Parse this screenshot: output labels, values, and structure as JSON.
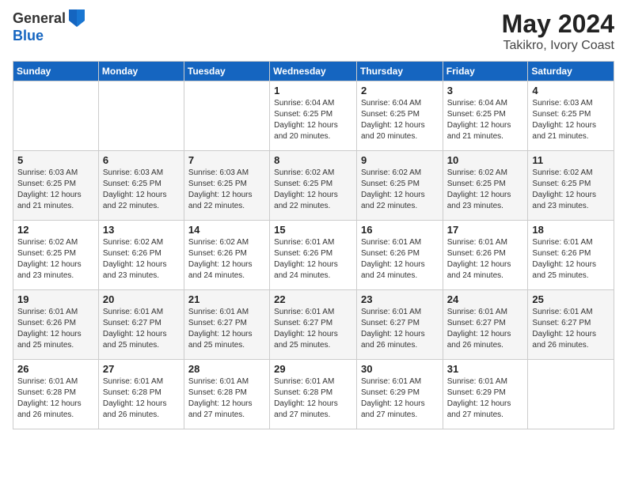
{
  "logo": {
    "general": "General",
    "blue": "Blue"
  },
  "title": "May 2024",
  "subtitle": "Takikro, Ivory Coast",
  "days_of_week": [
    "Sunday",
    "Monday",
    "Tuesday",
    "Wednesday",
    "Thursday",
    "Friday",
    "Saturday"
  ],
  "weeks": [
    [
      {
        "day": "",
        "info": ""
      },
      {
        "day": "",
        "info": ""
      },
      {
        "day": "",
        "info": ""
      },
      {
        "day": "1",
        "info": "Sunrise: 6:04 AM\nSunset: 6:25 PM\nDaylight: 12 hours\nand 20 minutes."
      },
      {
        "day": "2",
        "info": "Sunrise: 6:04 AM\nSunset: 6:25 PM\nDaylight: 12 hours\nand 20 minutes."
      },
      {
        "day": "3",
        "info": "Sunrise: 6:04 AM\nSunset: 6:25 PM\nDaylight: 12 hours\nand 21 minutes."
      },
      {
        "day": "4",
        "info": "Sunrise: 6:03 AM\nSunset: 6:25 PM\nDaylight: 12 hours\nand 21 minutes."
      }
    ],
    [
      {
        "day": "5",
        "info": "Sunrise: 6:03 AM\nSunset: 6:25 PM\nDaylight: 12 hours\nand 21 minutes."
      },
      {
        "day": "6",
        "info": "Sunrise: 6:03 AM\nSunset: 6:25 PM\nDaylight: 12 hours\nand 22 minutes."
      },
      {
        "day": "7",
        "info": "Sunrise: 6:03 AM\nSunset: 6:25 PM\nDaylight: 12 hours\nand 22 minutes."
      },
      {
        "day": "8",
        "info": "Sunrise: 6:02 AM\nSunset: 6:25 PM\nDaylight: 12 hours\nand 22 minutes."
      },
      {
        "day": "9",
        "info": "Sunrise: 6:02 AM\nSunset: 6:25 PM\nDaylight: 12 hours\nand 22 minutes."
      },
      {
        "day": "10",
        "info": "Sunrise: 6:02 AM\nSunset: 6:25 PM\nDaylight: 12 hours\nand 23 minutes."
      },
      {
        "day": "11",
        "info": "Sunrise: 6:02 AM\nSunset: 6:25 PM\nDaylight: 12 hours\nand 23 minutes."
      }
    ],
    [
      {
        "day": "12",
        "info": "Sunrise: 6:02 AM\nSunset: 6:25 PM\nDaylight: 12 hours\nand 23 minutes."
      },
      {
        "day": "13",
        "info": "Sunrise: 6:02 AM\nSunset: 6:26 PM\nDaylight: 12 hours\nand 23 minutes."
      },
      {
        "day": "14",
        "info": "Sunrise: 6:02 AM\nSunset: 6:26 PM\nDaylight: 12 hours\nand 24 minutes."
      },
      {
        "day": "15",
        "info": "Sunrise: 6:01 AM\nSunset: 6:26 PM\nDaylight: 12 hours\nand 24 minutes."
      },
      {
        "day": "16",
        "info": "Sunrise: 6:01 AM\nSunset: 6:26 PM\nDaylight: 12 hours\nand 24 minutes."
      },
      {
        "day": "17",
        "info": "Sunrise: 6:01 AM\nSunset: 6:26 PM\nDaylight: 12 hours\nand 24 minutes."
      },
      {
        "day": "18",
        "info": "Sunrise: 6:01 AM\nSunset: 6:26 PM\nDaylight: 12 hours\nand 25 minutes."
      }
    ],
    [
      {
        "day": "19",
        "info": "Sunrise: 6:01 AM\nSunset: 6:26 PM\nDaylight: 12 hours\nand 25 minutes."
      },
      {
        "day": "20",
        "info": "Sunrise: 6:01 AM\nSunset: 6:27 PM\nDaylight: 12 hours\nand 25 minutes."
      },
      {
        "day": "21",
        "info": "Sunrise: 6:01 AM\nSunset: 6:27 PM\nDaylight: 12 hours\nand 25 minutes."
      },
      {
        "day": "22",
        "info": "Sunrise: 6:01 AM\nSunset: 6:27 PM\nDaylight: 12 hours\nand 25 minutes."
      },
      {
        "day": "23",
        "info": "Sunrise: 6:01 AM\nSunset: 6:27 PM\nDaylight: 12 hours\nand 26 minutes."
      },
      {
        "day": "24",
        "info": "Sunrise: 6:01 AM\nSunset: 6:27 PM\nDaylight: 12 hours\nand 26 minutes."
      },
      {
        "day": "25",
        "info": "Sunrise: 6:01 AM\nSunset: 6:27 PM\nDaylight: 12 hours\nand 26 minutes."
      }
    ],
    [
      {
        "day": "26",
        "info": "Sunrise: 6:01 AM\nSunset: 6:28 PM\nDaylight: 12 hours\nand 26 minutes."
      },
      {
        "day": "27",
        "info": "Sunrise: 6:01 AM\nSunset: 6:28 PM\nDaylight: 12 hours\nand 26 minutes."
      },
      {
        "day": "28",
        "info": "Sunrise: 6:01 AM\nSunset: 6:28 PM\nDaylight: 12 hours\nand 27 minutes."
      },
      {
        "day": "29",
        "info": "Sunrise: 6:01 AM\nSunset: 6:28 PM\nDaylight: 12 hours\nand 27 minutes."
      },
      {
        "day": "30",
        "info": "Sunrise: 6:01 AM\nSunset: 6:29 PM\nDaylight: 12 hours\nand 27 minutes."
      },
      {
        "day": "31",
        "info": "Sunrise: 6:01 AM\nSunset: 6:29 PM\nDaylight: 12 hours\nand 27 minutes."
      },
      {
        "day": "",
        "info": ""
      }
    ]
  ]
}
